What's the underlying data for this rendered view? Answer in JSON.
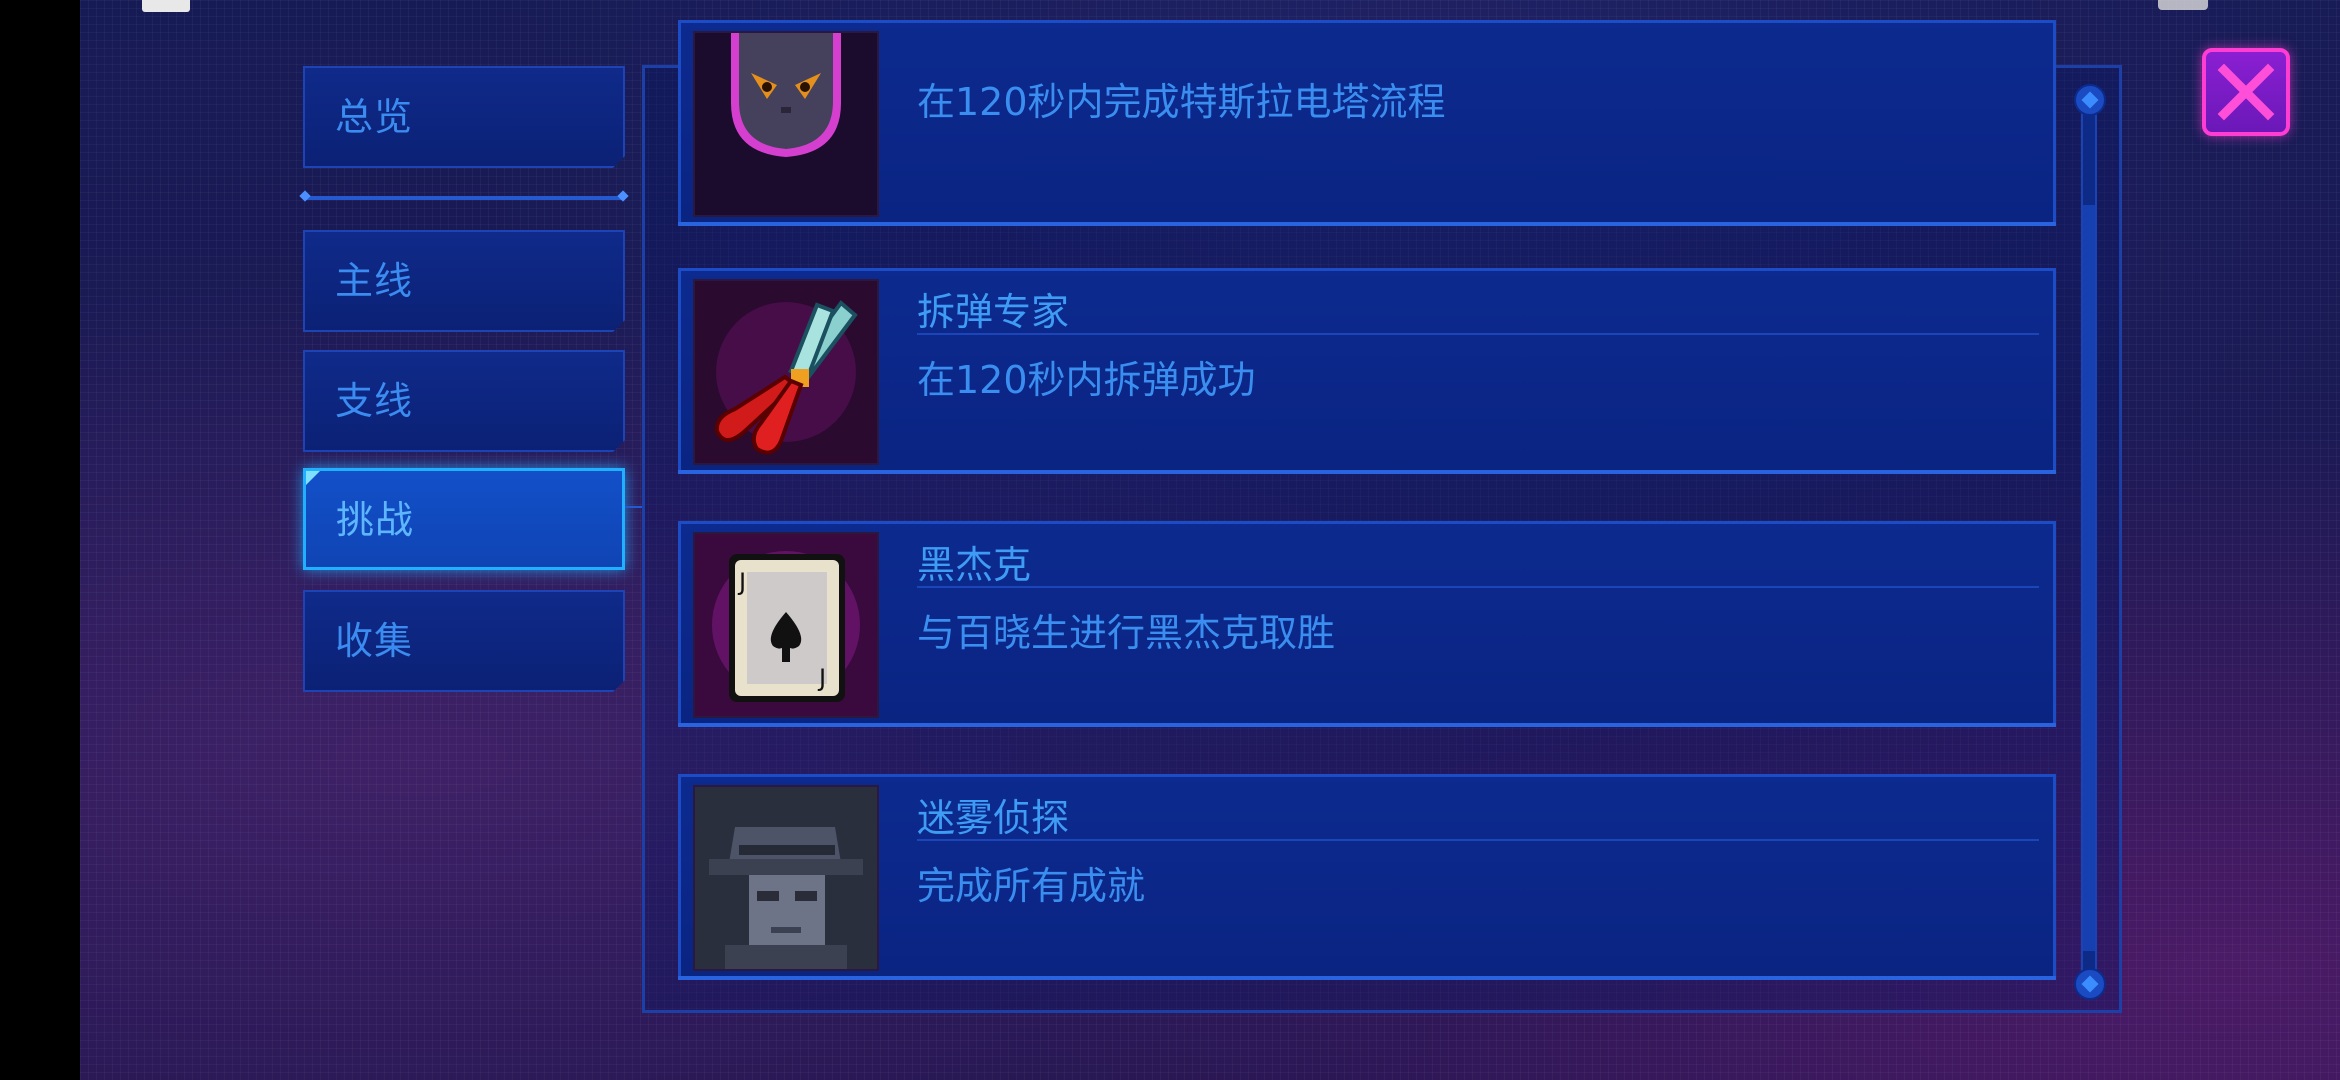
{
  "sidebar": {
    "tabs": [
      {
        "label": "总览",
        "active": false
      },
      {
        "label": "主线",
        "active": false
      },
      {
        "label": "支线",
        "active": false
      },
      {
        "label": "挑战",
        "active": true
      },
      {
        "label": "收集",
        "active": false
      }
    ]
  },
  "achievements": [
    {
      "title": "",
      "description": "在120秒内完成特斯拉电塔流程",
      "icon": "cat-icon"
    },
    {
      "title": "拆弹专家",
      "description": "在120秒内拆弹成功",
      "icon": "wire-cutter-icon"
    },
    {
      "title": "黑杰克",
      "description": "与百晓生进行黑杰克取胜",
      "icon": "playing-card-icon"
    },
    {
      "title": "迷雾侦探",
      "description": "完成所有成就",
      "icon": "detective-icon"
    }
  ],
  "colors": {
    "accent": "#1fb1ff",
    "text": "#3e9cf5",
    "close": "#ff3dd2"
  }
}
